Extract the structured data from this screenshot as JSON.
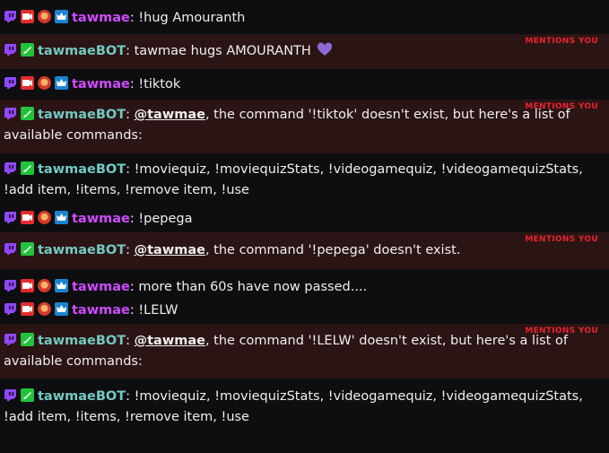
{
  "tag_mentions": "MENTIONS YOU",
  "colon": ": ",
  "messages": [
    {
      "user": "tawmae",
      "text": "!hug Amouranth"
    },
    {
      "user": "tawmaeBOT",
      "text": "tawmae hugs AMOURANTH"
    },
    {
      "user": "tawmae",
      "text": "!tiktok"
    },
    {
      "user": "tawmaeBOT",
      "mention": "@tawmae",
      "text": ", the command '!tiktok' doesn't exist, but here's a list of available commands:"
    },
    {
      "user": "tawmaeBOT",
      "text": "!moviequiz, !moviequizStats, !videogamequiz, !videogamequizStats, !add item, !items, !remove item, !use"
    },
    {
      "user": "tawmae",
      "text": "!pepega"
    },
    {
      "user": "tawmaeBOT",
      "mention": "@tawmae",
      "text": ", the command '!pepega' doesn't exist."
    },
    {
      "user": "tawmae",
      "text": "more than 60s have now passed...."
    },
    {
      "user": "tawmae",
      "text": "!LELW"
    },
    {
      "user": "tawmaeBOT",
      "mention": "@tawmae",
      "text": ", the command '!LELW' doesn't exist, but here's a list of available commands:"
    },
    {
      "user": "tawmaeBOT",
      "text": "!moviequiz, !moviequizStats, !videogamequiz, !videogamequizStats, !add item, !items, !remove item, !use"
    }
  ],
  "icons": {
    "twitch": "twitch-glitch-icon",
    "video": "video-badge-icon",
    "rocket": "rocket-badge-icon",
    "cat": "cat-badge-icon",
    "crown": "crown-badge-icon",
    "heart": "purple-heart-emoji-icon"
  },
  "colors": {
    "tawmae": "#cf4bff",
    "bot": "#73c9c2",
    "mention_bg": "#2b1414",
    "mention_tag": "#e8232d"
  }
}
